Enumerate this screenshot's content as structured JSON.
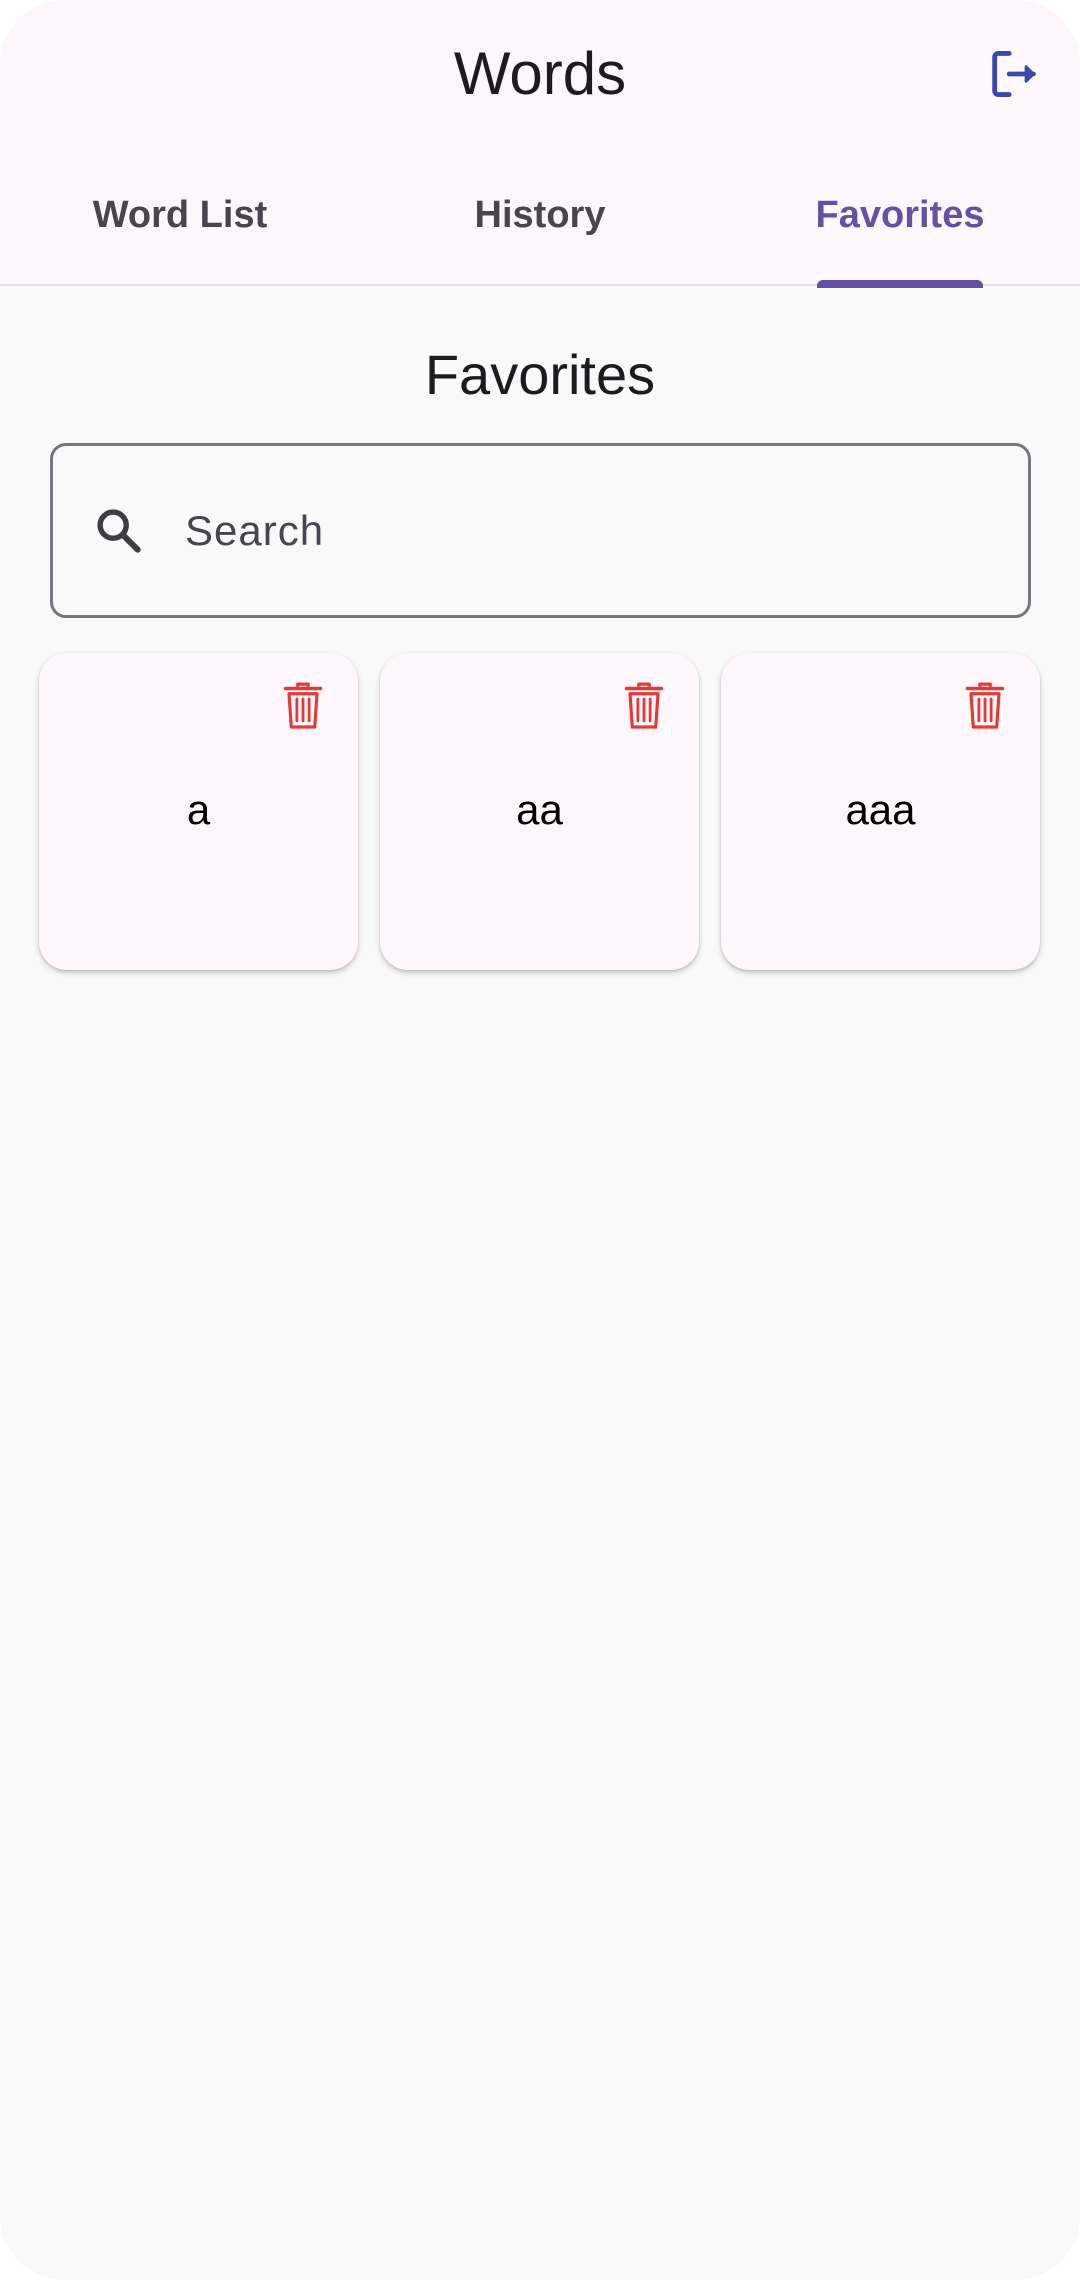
{
  "app": {
    "title": "Words",
    "logout_icon": "logout-icon"
  },
  "tabs": [
    {
      "label": "Word List",
      "active": false
    },
    {
      "label": "History",
      "active": false
    },
    {
      "label": "Favorites",
      "active": true
    }
  ],
  "main": {
    "heading": "Favorites",
    "search": {
      "placeholder": "Search",
      "value": "",
      "icon": "search-icon"
    },
    "favorites": [
      {
        "word": "a",
        "delete_icon": "trash-icon"
      },
      {
        "word": "aa",
        "delete_icon": "trash-icon"
      },
      {
        "word": "aaa",
        "delete_icon": "trash-icon"
      }
    ]
  },
  "colors": {
    "accent": "#6750a4",
    "logout_icon": "#3949ab",
    "delete_icon": "#e53935",
    "appbar_bg": "#fdf7fc",
    "page_bg": "#f9f9f9"
  }
}
